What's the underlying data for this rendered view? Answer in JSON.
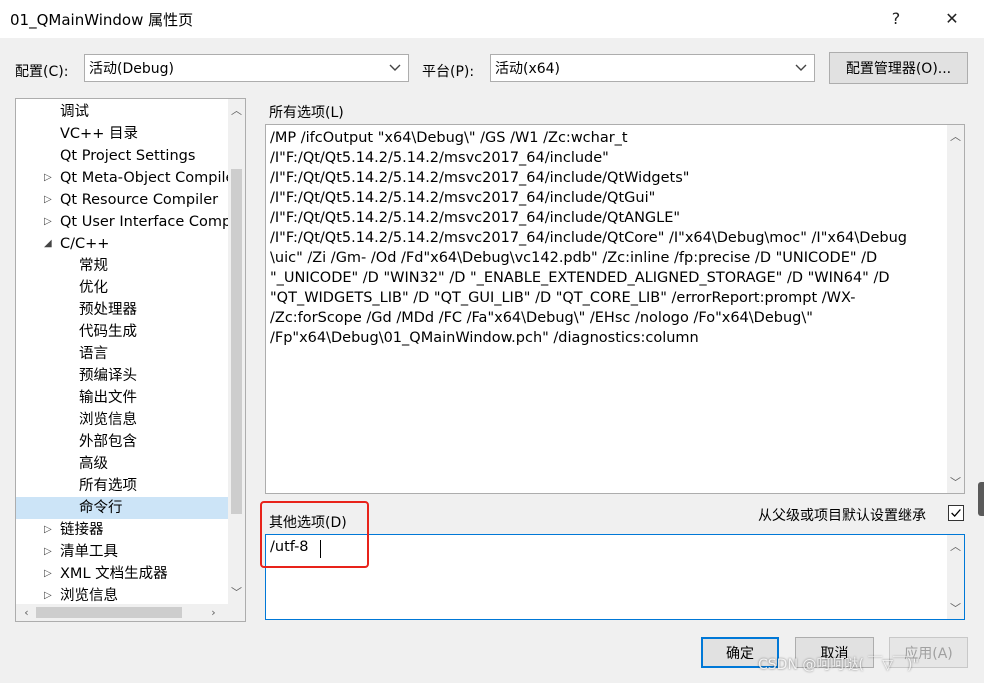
{
  "window": {
    "title": "01_QMainWindow 属性页",
    "help_label": "?",
    "close_label": "✕"
  },
  "config": {
    "label": "配置(C):",
    "value": "活动(Debug)"
  },
  "platform": {
    "label": "平台(P):",
    "value": "活动(x64)"
  },
  "config_manager_label": "配置管理器(O)...",
  "tree": {
    "items": [
      {
        "label": "调试",
        "expander": ""
      },
      {
        "label": "VC++ 目录",
        "expander": ""
      },
      {
        "label": "Qt Project Settings",
        "expander": ""
      },
      {
        "label": "Qt Meta-Object Compiler",
        "expander": "▷"
      },
      {
        "label": "Qt Resource Compiler",
        "expander": "▷"
      },
      {
        "label": "Qt User Interface Compiler",
        "expander": "▷"
      },
      {
        "label": "C/C++",
        "expander": "◢"
      },
      {
        "label": "常规",
        "expander": ""
      },
      {
        "label": "优化",
        "expander": ""
      },
      {
        "label": "预处理器",
        "expander": ""
      },
      {
        "label": "代码生成",
        "expander": ""
      },
      {
        "label": "语言",
        "expander": ""
      },
      {
        "label": "预编译头",
        "expander": ""
      },
      {
        "label": "输出文件",
        "expander": ""
      },
      {
        "label": "浏览信息",
        "expander": ""
      },
      {
        "label": "外部包含",
        "expander": ""
      },
      {
        "label": "高级",
        "expander": ""
      },
      {
        "label": "所有选项",
        "expander": ""
      },
      {
        "label": "命令行",
        "expander": ""
      },
      {
        "label": "链接器",
        "expander": "▷"
      },
      {
        "label": "清单工具",
        "expander": "▷"
      },
      {
        "label": "XML 文档生成器",
        "expander": "▷"
      },
      {
        "label": "浏览信息",
        "expander": "▷"
      }
    ],
    "selected_index": 18
  },
  "all_options": {
    "label": "所有选项(L)",
    "lines": [
      "/MP /ifcOutput \"x64\\Debug\\\" /GS /W1 /Zc:wchar_t",
      "/I\"F:/Qt/Qt5.14.2/5.14.2/msvc2017_64/include\"",
      "/I\"F:/Qt/Qt5.14.2/5.14.2/msvc2017_64/include/QtWidgets\"",
      "/I\"F:/Qt/Qt5.14.2/5.14.2/msvc2017_64/include/QtGui\"",
      "/I\"F:/Qt/Qt5.14.2/5.14.2/msvc2017_64/include/QtANGLE\"",
      "/I\"F:/Qt/Qt5.14.2/5.14.2/msvc2017_64/include/QtCore\" /I\"x64\\Debug\\moc\" /I\"x64\\Debug",
      "\\uic\" /Zi /Gm- /Od /Fd\"x64\\Debug\\vc142.pdb\" /Zc:inline /fp:precise /D \"UNICODE\" /D",
      "\"_UNICODE\" /D \"WIN32\" /D \"_ENABLE_EXTENDED_ALIGNED_STORAGE\" /D \"WIN64\" /D",
      "\"QT_WIDGETS_LIB\" /D \"QT_GUI_LIB\" /D \"QT_CORE_LIB\" /errorReport:prompt /WX-",
      "/Zc:forScope /Gd /MDd /FC /Fa\"x64\\Debug\\\" /EHsc /nologo /Fo\"x64\\Debug\\\"",
      "/Fp\"x64\\Debug\\01_QMainWindow.pch\" /diagnostics:column"
    ]
  },
  "other_options": {
    "label": "其他选项(D)",
    "value": "/utf-8"
  },
  "inherit": {
    "label": "从父级或项目默认设置继承",
    "checked": true
  },
  "buttons": {
    "ok": "确定",
    "cancel": "取消",
    "apply": "应用(A)"
  },
  "watermark": "CSDN @呵呵哒( ￣▽￣)\""
}
